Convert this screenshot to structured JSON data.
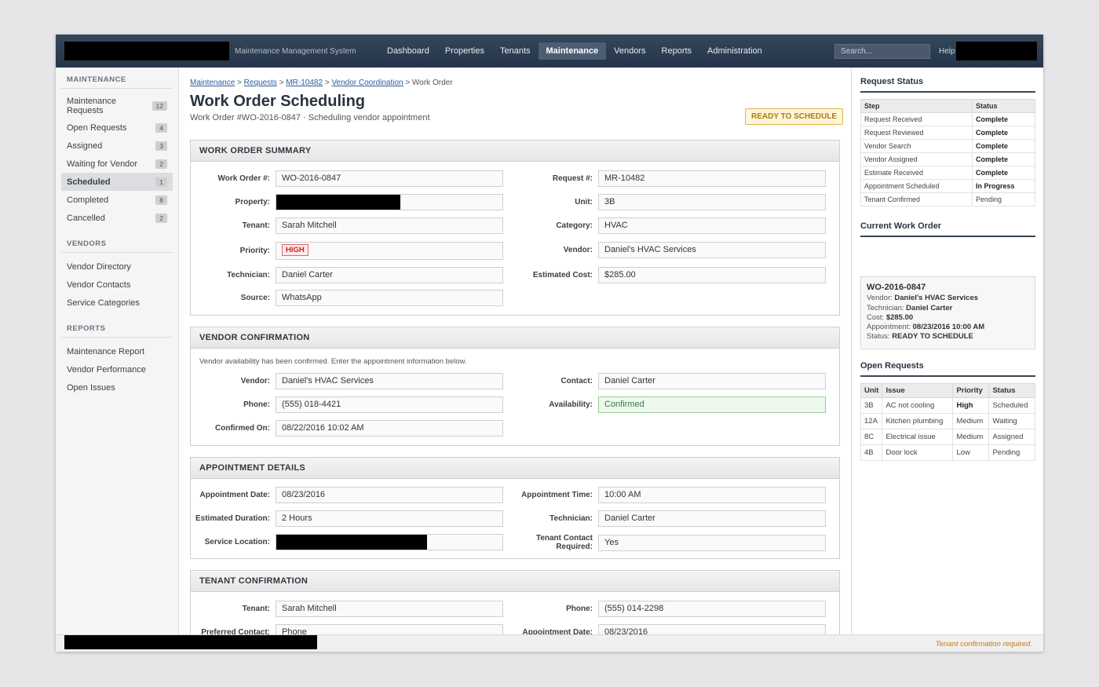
{
  "app": {
    "system_name": "Maintenance Management System"
  },
  "nav": {
    "items": [
      "Dashboard",
      "Properties",
      "Tenants",
      "Maintenance",
      "Vendors",
      "Reports",
      "Administration"
    ],
    "active": "Maintenance"
  },
  "search": {
    "placeholder": "Search..."
  },
  "help_label": "Help",
  "sidebar": {
    "maintenance": {
      "heading": "MAINTENANCE",
      "items": [
        {
          "label": "Maintenance Requests",
          "count": "12"
        },
        {
          "label": "Open Requests",
          "count": "4"
        },
        {
          "label": "Assigned",
          "count": "3"
        },
        {
          "label": "Waiting for Vendor",
          "count": "2"
        },
        {
          "label": "Scheduled",
          "count": "1"
        },
        {
          "label": "Completed",
          "count": "8"
        },
        {
          "label": "Cancelled",
          "count": "2"
        }
      ]
    },
    "vendors": {
      "heading": "VENDORS",
      "items": [
        "Vendor Directory",
        "Vendor Contacts",
        "Service Categories"
      ]
    },
    "reports": {
      "heading": "REPORTS",
      "items": [
        "Maintenance Report",
        "Vendor Performance",
        "Open Issues"
      ]
    }
  },
  "breadcrumb": {
    "links": [
      "Maintenance",
      "Requests",
      "MR-10482",
      "Vendor Coordination"
    ],
    "separator": ">",
    "current": "Work Order"
  },
  "page": {
    "title": "Work Order Scheduling",
    "subtitle": "Work Order #WO-2016-0847 · Scheduling vendor appointment",
    "status": "READY TO SCHEDULE"
  },
  "summary": {
    "heading": "WORK ORDER SUMMARY",
    "work_order_label": "Work Order #:",
    "work_order": "WO-2016-0847",
    "request_label": "Request #:",
    "request": "MR-10482",
    "property_label": "Property:",
    "unit_label": "Unit:",
    "unit": "3B",
    "tenant_label": "Tenant:",
    "tenant": "Sarah Mitchell",
    "category_label": "Category:",
    "category": "HVAC",
    "priority_label": "Priority:",
    "priority": "HIGH",
    "vendor_label": "Vendor:",
    "vendor": "Daniel's HVAC Services",
    "technician_label": "Technician:",
    "technician": "Daniel Carter",
    "cost_label": "Estimated Cost:",
    "cost": "$285.00",
    "source_label": "Source:",
    "source": "WhatsApp"
  },
  "vendor_conf": {
    "heading": "VENDOR CONFIRMATION",
    "note": "Vendor availability has been confirmed. Enter the appointment information below.",
    "vendor_label": "Vendor:",
    "vendor": "Daniel's HVAC Services",
    "contact_label": "Contact:",
    "contact": "Daniel Carter",
    "phone_label": "Phone:",
    "phone": "(555) 018-4421",
    "availability_label": "Availability:",
    "availability": "Confirmed",
    "confirmed_label": "Confirmed On:",
    "confirmed": "08/22/2016 10:02 AM"
  },
  "appointment": {
    "heading": "APPOINTMENT DETAILS",
    "date_label": "Appointment Date:",
    "date": "08/23/2016",
    "time_label": "Appointment Time:",
    "time": "10:00 AM",
    "duration_label": "Estimated Duration:",
    "duration": "2 Hours",
    "technician_label": "Technician:",
    "technician": "Daniel Carter",
    "location_label": "Service Location:",
    "contact_req_label": "Tenant Contact Required:",
    "contact_req": "Yes"
  },
  "tenant_conf": {
    "heading": "TENANT CONFIRMATION",
    "tenant_label": "Tenant:",
    "tenant": "Sarah Mitchell",
    "phone_label": "Phone:",
    "phone": "(555) 014-2298",
    "pref_label": "Preferred Contact:",
    "pref": "Phone",
    "date_label": "Appointment Date:",
    "date": "08/23/2016"
  },
  "request_status": {
    "heading": "Request Status",
    "columns": [
      "Step",
      "Status"
    ],
    "rows": [
      [
        "Request Received",
        "Complete"
      ],
      [
        "Request Reviewed",
        "Complete"
      ],
      [
        "Vendor Search",
        "Complete"
      ],
      [
        "Vendor Assigned",
        "Complete"
      ],
      [
        "Estimate Received",
        "Complete"
      ],
      [
        "Appointment Scheduled",
        "In Progress"
      ],
      [
        "Tenant Confirmed",
        "Pending"
      ]
    ]
  },
  "current_wo": {
    "heading": "Current Work Order",
    "id": "WO-2016-0847",
    "vendor_label": "Vendor:",
    "vendor": "Daniel's HVAC Services",
    "technician_label": "Technician:",
    "technician": "Daniel Carter",
    "cost_label": "Cost:",
    "cost": "$285.00",
    "appointment_label": "Appointment:",
    "appointment": "08/23/2016 10:00 AM",
    "status_label": "Status:",
    "status": "READY TO SCHEDULE"
  },
  "open_requests": {
    "heading": "Open Requests",
    "columns": [
      "Unit",
      "Issue",
      "Priority",
      "Status"
    ],
    "rows": [
      [
        "3B",
        "AC not cooling",
        "High",
        "Scheduled"
      ],
      [
        "12A",
        "Kitchen plumbing",
        "Medium",
        "Waiting"
      ],
      [
        "8C",
        "Electrical issue",
        "Medium",
        "Assigned"
      ],
      [
        "4B",
        "Door lock",
        "Low",
        "Pending"
      ]
    ]
  },
  "footer": {
    "message": "Tenant confirmation required."
  }
}
